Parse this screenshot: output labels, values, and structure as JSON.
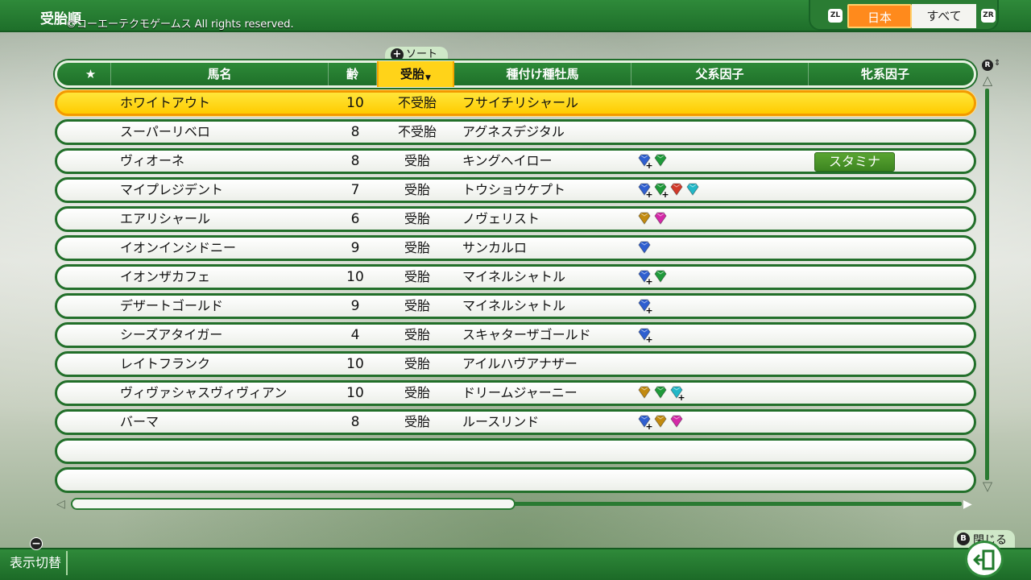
{
  "header": {
    "title": "受胎順",
    "copyright": "©コーエーテクモゲームス All rights reserved.",
    "zl": "ZL",
    "zr": "ZR",
    "tabs": [
      {
        "label": "日本",
        "selected": true
      },
      {
        "label": "すべて",
        "selected": false
      }
    ]
  },
  "sort_hint": {
    "button": "+",
    "label": "ソート"
  },
  "columns": {
    "star": "★",
    "name": "馬名",
    "age": "齢",
    "status": "受胎",
    "sire": "種付け種牡馬",
    "sire_factor": "父系因子",
    "dam_factor": "牝系因子"
  },
  "rows": [
    {
      "name": "ホワイトアウト",
      "age": "10",
      "status": "不受胎",
      "sire": "フサイチリシャール",
      "factors": [],
      "dam_factor": "",
      "selected": true
    },
    {
      "name": "スーパーリベロ",
      "age": "8",
      "status": "不受胎",
      "sire": "アグネスデジタル",
      "factors": [],
      "dam_factor": ""
    },
    {
      "name": "ヴィオーネ",
      "age": "8",
      "status": "受胎",
      "sire": "キングヘイロー",
      "factors": [
        {
          "icon": "blue-gem-icon",
          "color": "#2f5fd0",
          "plus": true
        },
        {
          "icon": "green-gem-icon",
          "color": "#1f9a3a",
          "plus": false
        }
      ],
      "dam_factor": "スタミナ"
    },
    {
      "name": "マイプレジデント",
      "age": "7",
      "status": "受胎",
      "sire": "トウショウケプト",
      "factors": [
        {
          "icon": "blue-gem-icon",
          "color": "#2f5fd0",
          "plus": true
        },
        {
          "icon": "green-gem-icon",
          "color": "#1f9a3a",
          "plus": true
        },
        {
          "icon": "red-gem-icon",
          "color": "#d23a2a",
          "plus": false
        },
        {
          "icon": "cyan-gem-icon",
          "color": "#22b8c8",
          "plus": false
        }
      ],
      "dam_factor": ""
    },
    {
      "name": "エアリシャール",
      "age": "6",
      "status": "受胎",
      "sire": "ノヴェリスト",
      "factors": [
        {
          "icon": "gold-gem-icon",
          "color": "#c28a10",
          "plus": false
        },
        {
          "icon": "magenta-gem-icon",
          "color": "#d42aa8",
          "plus": false
        }
      ],
      "dam_factor": ""
    },
    {
      "name": "イオンインシドニー",
      "age": "9",
      "status": "受胎",
      "sire": "サンカルロ",
      "factors": [
        {
          "icon": "blue-gem-icon",
          "color": "#2f5fd0",
          "plus": false
        }
      ],
      "dam_factor": ""
    },
    {
      "name": "イオンザカフェ",
      "age": "10",
      "status": "受胎",
      "sire": "マイネルシャトル",
      "factors": [
        {
          "icon": "blue-gem-icon",
          "color": "#2f5fd0",
          "plus": true
        },
        {
          "icon": "green-gem-icon",
          "color": "#1f9a3a",
          "plus": false
        }
      ],
      "dam_factor": ""
    },
    {
      "name": "デザートゴールド",
      "age": "9",
      "status": "受胎",
      "sire": "マイネルシャトル",
      "factors": [
        {
          "icon": "blue-gem-icon",
          "color": "#2f5fd0",
          "plus": true
        }
      ],
      "dam_factor": ""
    },
    {
      "name": "シーズアタイガー",
      "age": "4",
      "status": "受胎",
      "sire": "スキャターザゴールド",
      "factors": [
        {
          "icon": "blue-gem-icon",
          "color": "#2f5fd0",
          "plus": true
        }
      ],
      "dam_factor": ""
    },
    {
      "name": "レイトフランク",
      "age": "10",
      "status": "受胎",
      "sire": "アイルハヴアナザー",
      "factors": [],
      "dam_factor": ""
    },
    {
      "name": "ヴィヴァシャスヴィヴィアン",
      "age": "10",
      "status": "受胎",
      "sire": "ドリームジャーニー",
      "factors": [
        {
          "icon": "gold-gem-icon",
          "color": "#c28a10",
          "plus": false
        },
        {
          "icon": "green-gem-icon",
          "color": "#1f9a3a",
          "plus": false
        },
        {
          "icon": "cyan-gem-icon",
          "color": "#22b8c8",
          "plus": true
        }
      ],
      "dam_factor": ""
    },
    {
      "name": "バーマ",
      "age": "8",
      "status": "受胎",
      "sire": "ルースリンド",
      "factors": [
        {
          "icon": "blue-gem-icon",
          "color": "#2f5fd0",
          "plus": true
        },
        {
          "icon": "gold-gem-icon",
          "color": "#c28a10",
          "plus": false
        },
        {
          "icon": "magenta-gem-icon",
          "color": "#d42aa8",
          "plus": false
        }
      ],
      "dam_factor": ""
    },
    {
      "name": "",
      "age": "",
      "status": "",
      "sire": "",
      "factors": [],
      "dam_factor": ""
    },
    {
      "name": "",
      "age": "",
      "status": "",
      "sire": "",
      "factors": [],
      "dam_factor": ""
    }
  ],
  "scroll": {
    "r_button": "R"
  },
  "footer": {
    "minus": "−",
    "toggle_label": "表示切替",
    "b_button": "B",
    "close_label": "閉じる"
  }
}
